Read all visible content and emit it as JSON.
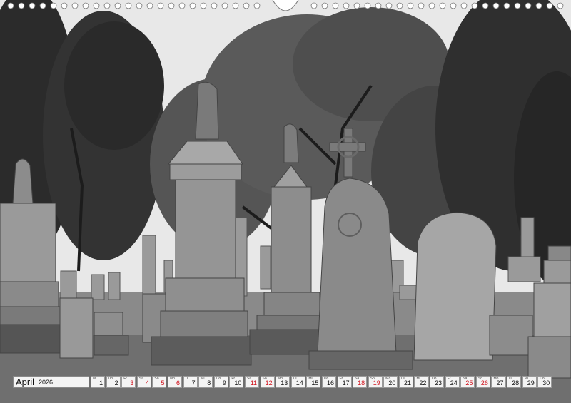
{
  "calendar": {
    "month": "April",
    "year": "2026",
    "days": [
      {
        "wd": "Mi",
        "num": "1",
        "red": false
      },
      {
        "wd": "Do",
        "num": "2",
        "red": false
      },
      {
        "wd": "Fr",
        "num": "3",
        "red": true
      },
      {
        "wd": "Sa",
        "num": "4",
        "red": true
      },
      {
        "wd": "So",
        "num": "5",
        "red": true
      },
      {
        "wd": "Mo",
        "num": "6",
        "red": true
      },
      {
        "wd": "Di",
        "num": "7",
        "red": false
      },
      {
        "wd": "Mi",
        "num": "8",
        "red": false
      },
      {
        "wd": "Do",
        "num": "9",
        "red": false
      },
      {
        "wd": "Fr",
        "num": "10",
        "red": false
      },
      {
        "wd": "Sa",
        "num": "11",
        "red": true
      },
      {
        "wd": "So",
        "num": "12",
        "red": true
      },
      {
        "wd": "Mo",
        "num": "13",
        "red": false
      },
      {
        "wd": "Di",
        "num": "14",
        "red": false
      },
      {
        "wd": "Mi",
        "num": "15",
        "red": false
      },
      {
        "wd": "Do",
        "num": "16",
        "red": false
      },
      {
        "wd": "Fr",
        "num": "17",
        "red": false
      },
      {
        "wd": "Sa",
        "num": "18",
        "red": true
      },
      {
        "wd": "So",
        "num": "19",
        "red": true
      },
      {
        "wd": "Mo",
        "num": "20",
        "red": false
      },
      {
        "wd": "Di",
        "num": "21",
        "red": false
      },
      {
        "wd": "Mi",
        "num": "22",
        "red": false
      },
      {
        "wd": "Do",
        "num": "23",
        "red": false
      },
      {
        "wd": "Fr",
        "num": "24",
        "red": false
      },
      {
        "wd": "Sa",
        "num": "25",
        "red": true
      },
      {
        "wd": "So",
        "num": "26",
        "red": true
      },
      {
        "wd": "Mo",
        "num": "27",
        "red": false
      },
      {
        "wd": "Di",
        "num": "28",
        "red": false
      },
      {
        "wd": "Mi",
        "num": "29",
        "red": false
      },
      {
        "wd": "Do",
        "num": "30",
        "red": false
      }
    ]
  },
  "colors": {
    "holiday_red": "#d0101a",
    "sky": "#e6e6e6"
  }
}
